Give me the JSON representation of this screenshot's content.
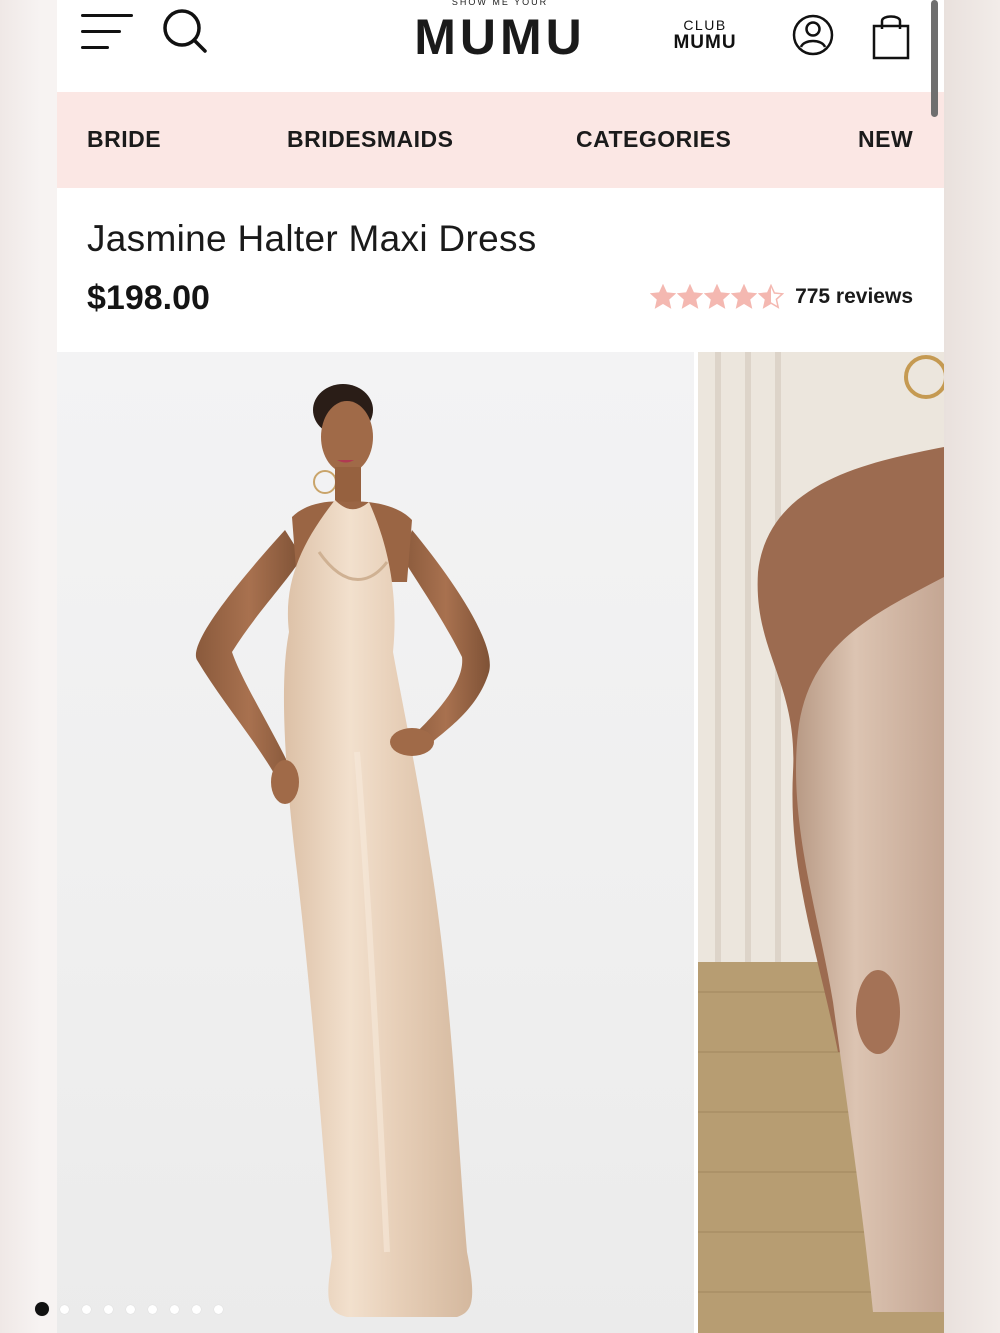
{
  "header": {
    "logo_small": "SHOW ME YOUR",
    "logo_big": "MUMU",
    "club_top": "CLUB",
    "club_bottom": "MUMU"
  },
  "nav": {
    "items": [
      {
        "label": "BRIDE"
      },
      {
        "label": "BRIDESMAIDS"
      },
      {
        "label": "CATEGORIES"
      },
      {
        "label": "NEW"
      }
    ]
  },
  "product": {
    "title": "Jasmine Halter Maxi Dress",
    "price": "$198.00",
    "rating": 4.5,
    "rating_max": 5,
    "reviews": "775 reviews",
    "star_color": "#f4b8b1"
  },
  "gallery": {
    "image_count": 9,
    "active_index": 0
  },
  "colors": {
    "nav_background": "#fbe7e4",
    "text": "#1a1a1a",
    "dress": "#e9d2bd"
  }
}
